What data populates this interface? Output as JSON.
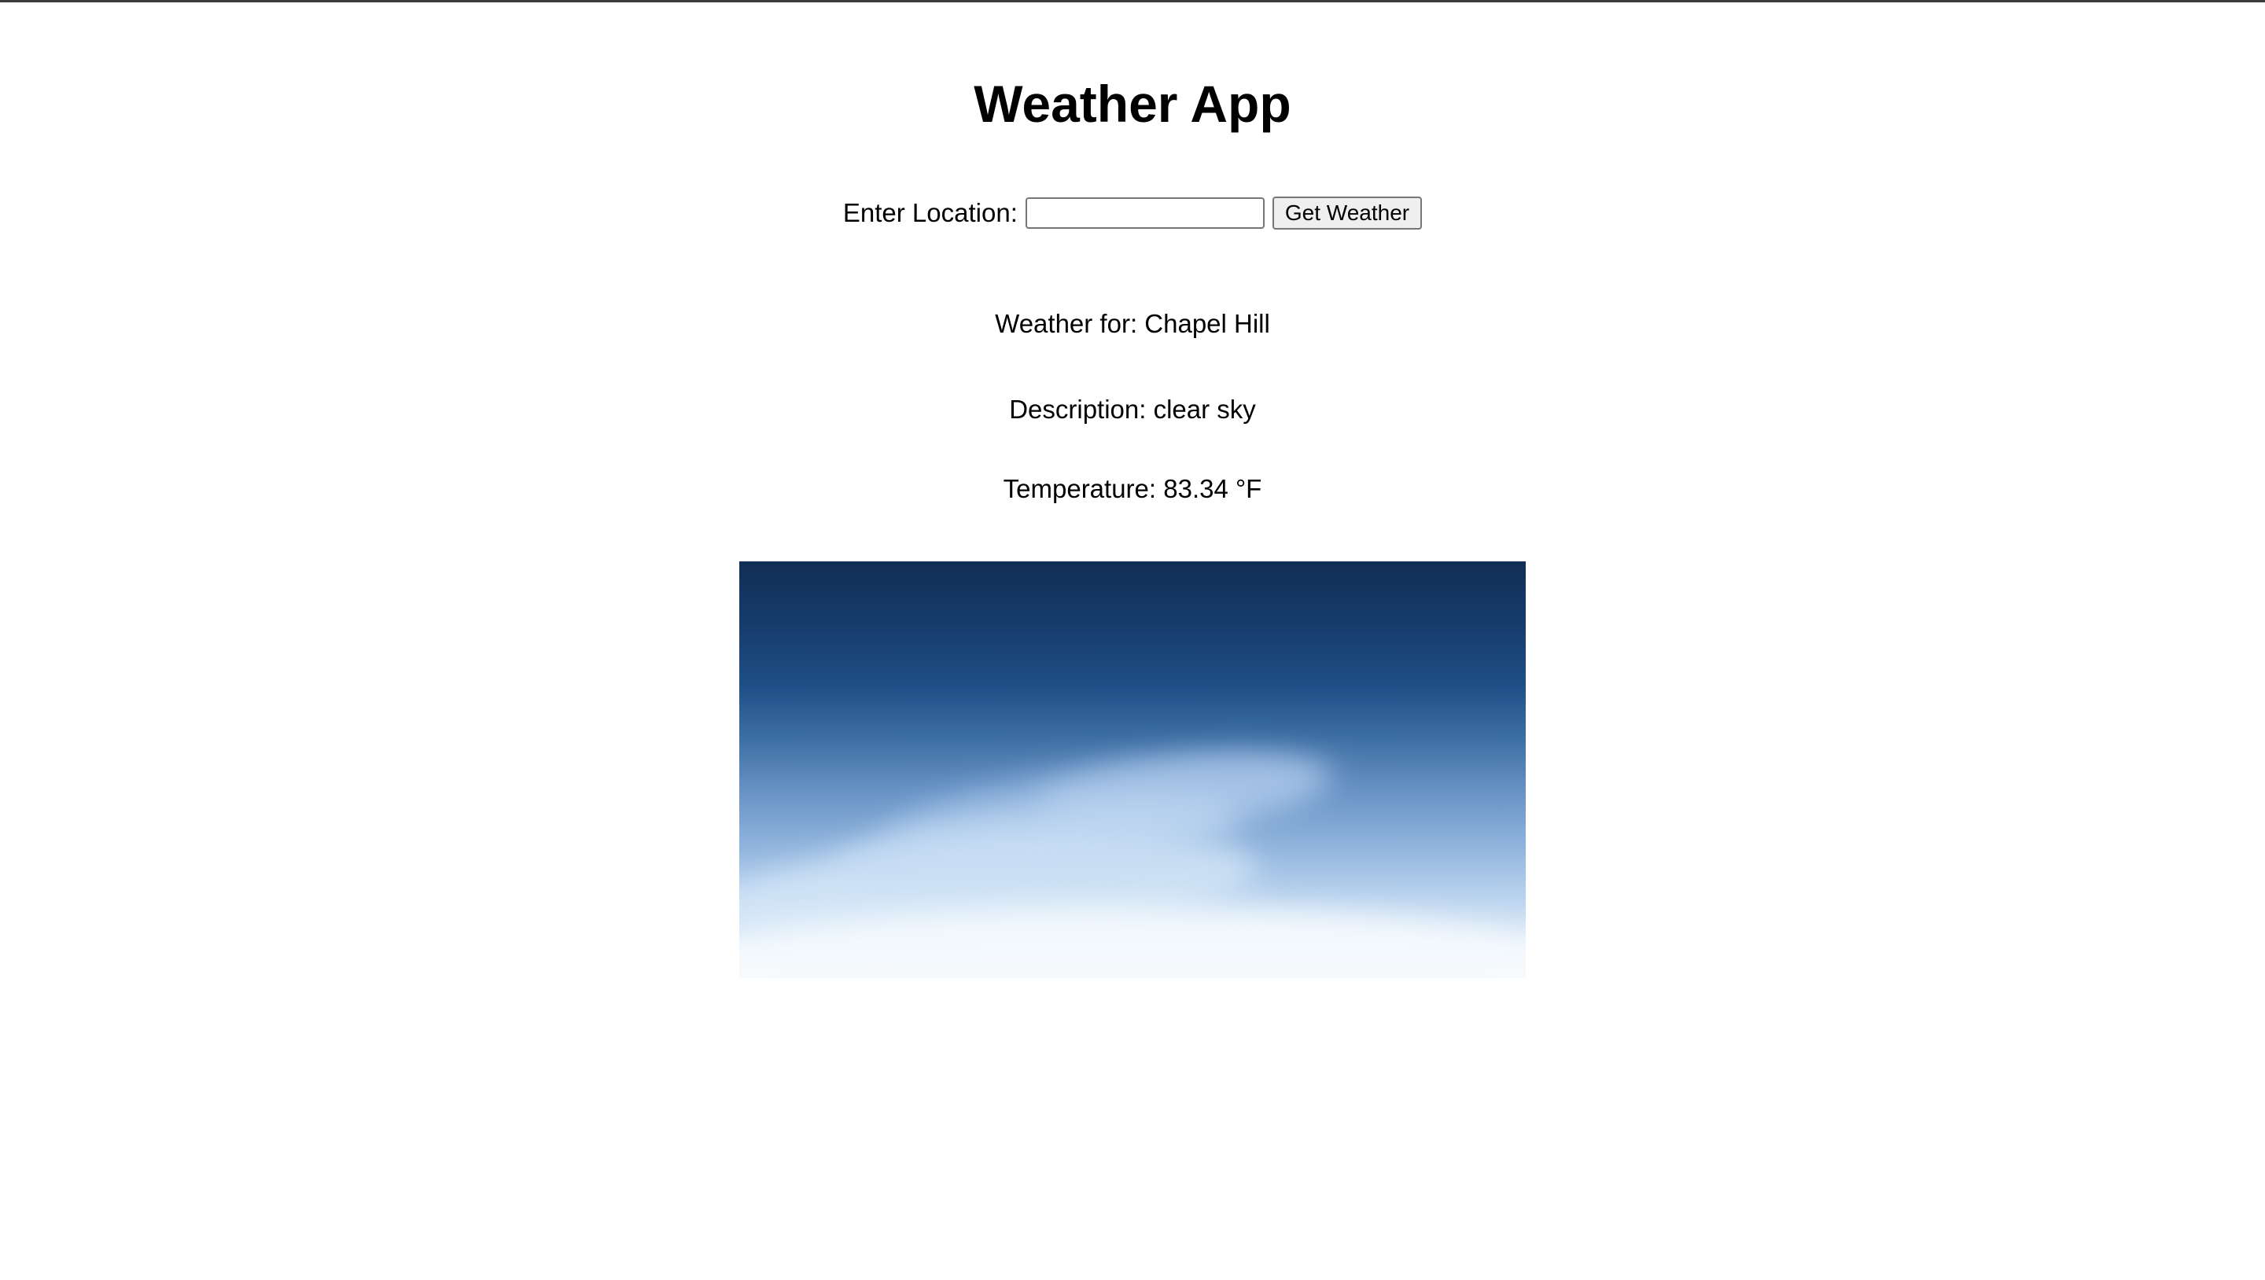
{
  "app": {
    "title": "Weather App"
  },
  "search": {
    "label": "Enter Location:",
    "value": "",
    "placeholder": "",
    "button_label": "Get Weather"
  },
  "result": {
    "location_line": "Weather for: Chapel Hill",
    "description_line": "Description: clear sky",
    "temperature_line": "Temperature: 83.34 °F"
  },
  "image": {
    "subject": "clear-sky",
    "colors": {
      "top": "#112e55",
      "middle": "#6792c4",
      "bottom": "#ffffff"
    }
  }
}
